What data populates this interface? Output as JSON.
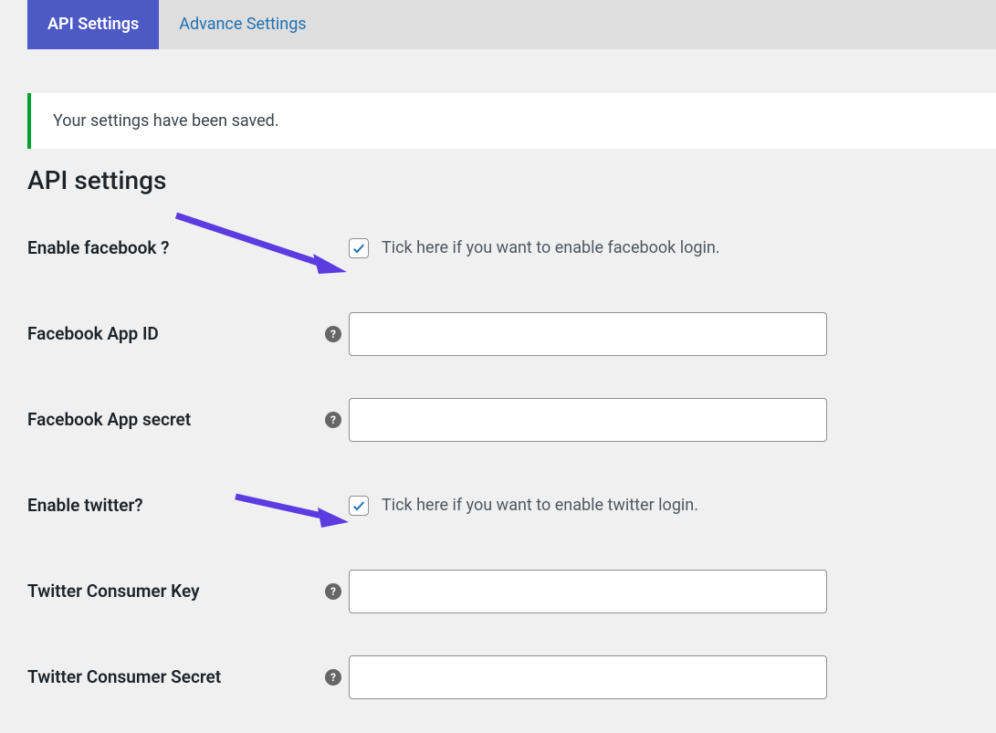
{
  "tabs": {
    "api": "API Settings",
    "advance": "Advance Settings"
  },
  "notice": "Your settings have been saved.",
  "heading": "API settings",
  "fields": {
    "enable_fb_label": "Enable facebook ?",
    "enable_fb_desc": "Tick here if you want to enable facebook login.",
    "fb_app_id_label": "Facebook App ID",
    "fb_app_id_value": "",
    "fb_app_secret_label": "Facebook App secret",
    "fb_app_secret_value": "",
    "enable_tw_label": "Enable twitter?",
    "enable_tw_desc": "Tick here if you want to enable twitter login.",
    "tw_key_label": "Twitter Consumer Key",
    "tw_key_value": "",
    "tw_secret_label": "Twitter Consumer Secret",
    "tw_secret_value": ""
  },
  "state": {
    "enable_fb_checked": true,
    "enable_tw_checked": true
  },
  "help_glyph": "?"
}
